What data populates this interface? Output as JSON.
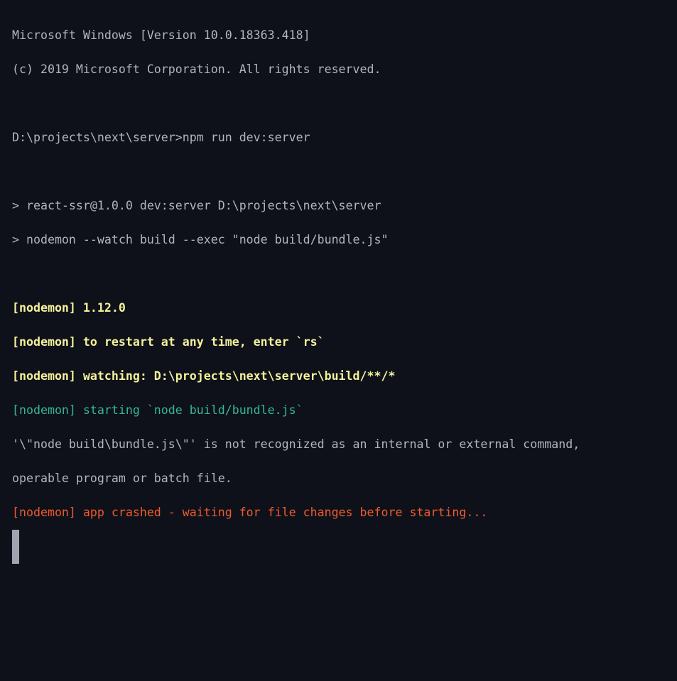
{
  "terminal": {
    "lines": [
      {
        "text": "Microsoft Windows [Version 10.0.18363.418]",
        "color": "gray"
      },
      {
        "text": "(c) 2019 Microsoft Corporation. All rights reserved.",
        "color": "gray"
      },
      {
        "text": "",
        "color": "gray"
      },
      {
        "text": "D:\\projects\\next\\server>npm run dev:server",
        "color": "gray"
      },
      {
        "text": "",
        "color": "gray"
      },
      {
        "text": "> react-ssr@1.0.0 dev:server D:\\projects\\next\\server",
        "color": "gray"
      },
      {
        "text": "> nodemon --watch build --exec \"node build/bundle.js\"",
        "color": "gray"
      },
      {
        "text": "",
        "color": "gray"
      },
      {
        "text": "[nodemon] 1.12.0",
        "color": "yellow"
      },
      {
        "text": "[nodemon] to restart at any time, enter `rs`",
        "color": "yellow"
      },
      {
        "text": "[nodemon] watching: D:\\projects\\next\\server\\build/**/*",
        "color": "yellow"
      },
      {
        "text": "[nodemon] starting `node build/bundle.js`",
        "color": "green"
      },
      {
        "text": "'\\\"node build\\bundle.js\\\"' is not recognized as an internal or external command,",
        "color": "gray"
      },
      {
        "text": "operable program or batch file.",
        "color": "gray"
      },
      {
        "text": "[nodemon] app crashed - waiting for file changes before starting...",
        "color": "red"
      }
    ]
  },
  "colors": {
    "background": "#0e111a",
    "gray": "#b2b5be",
    "yellow": "#f4f19a",
    "green": "#35b896",
    "red": "#ef5a2c",
    "cursor": "#a1a4b0"
  }
}
